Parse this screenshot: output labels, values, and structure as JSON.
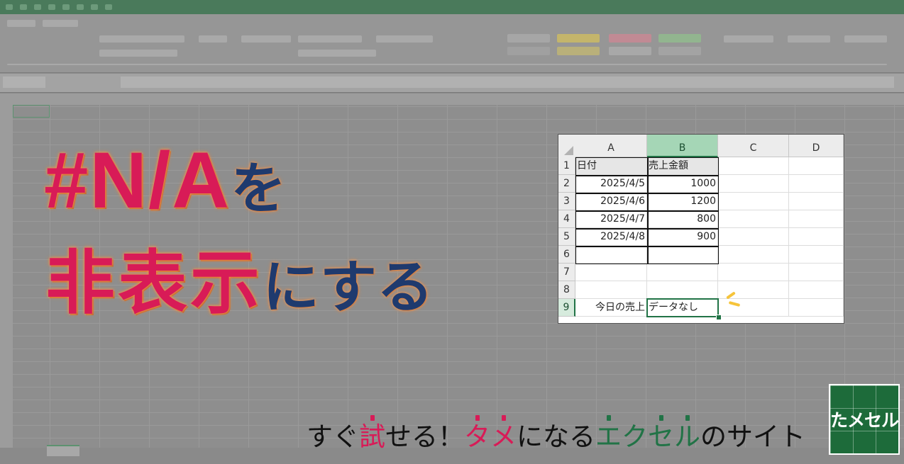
{
  "headline": {
    "line1_main": "#N/A",
    "line1_suffix": "を",
    "line2_main": "非表示",
    "line2_suffix": "にする"
  },
  "spreadsheet": {
    "columns": [
      "A",
      "B",
      "C",
      "D"
    ],
    "selected_column": "B",
    "selected_row": "9",
    "rows": [
      {
        "num": "1",
        "a": "日付",
        "b": "売上金額"
      },
      {
        "num": "2",
        "a": "2025/4/5",
        "b": "1000"
      },
      {
        "num": "3",
        "a": "2025/4/6",
        "b": "1200"
      },
      {
        "num": "4",
        "a": "2025/4/7",
        "b": "800"
      },
      {
        "num": "5",
        "a": "2025/4/8",
        "b": "900"
      },
      {
        "num": "6",
        "a": "",
        "b": ""
      },
      {
        "num": "7",
        "a": "",
        "b": ""
      },
      {
        "num": "8",
        "a": "",
        "b": ""
      },
      {
        "num": "9",
        "a": "今日の売上",
        "b": "データなし"
      }
    ]
  },
  "tagline": {
    "part1": "すぐ",
    "part2": "試",
    "part3": "せる！",
    "part4_a": "タ",
    "part4_b": "メ",
    "part5": "になる",
    "part6_a": "エ",
    "part6_b": "ク",
    "part6_c": "セ",
    "part6_d": "ル",
    "part7": "のサイト"
  },
  "logo": {
    "text": "たメセル"
  },
  "colors": {
    "accent_pink": "#d81b57",
    "accent_navy": "#1f3a6e",
    "excel_green": "#217346"
  }
}
